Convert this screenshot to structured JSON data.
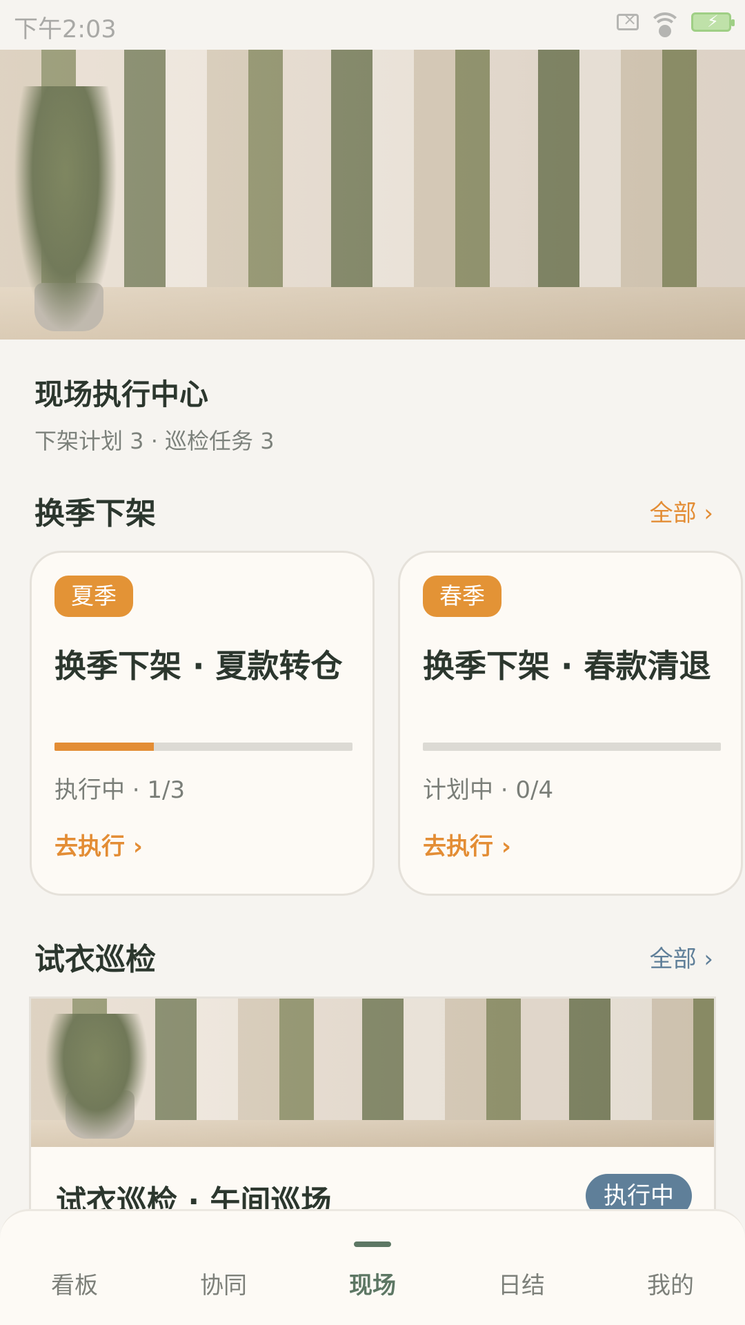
{
  "status_bar": {
    "time": "下午2:03"
  },
  "header": {
    "title": "现场执行中心",
    "subtitle": "下架计划 3 · 巡检任务 3"
  },
  "season_section": {
    "title": "换季下架",
    "all_label": "全部 ›",
    "link_color": "#e38d35",
    "cards": [
      {
        "tag": "夏季",
        "title": "换季下架 · 夏款转仓",
        "progress": 0.333,
        "status": "执行中 · 1/3",
        "action": "去执行 ›"
      },
      {
        "tag": "春季",
        "title": "换季下架 · 春款清退",
        "progress": 0,
        "status": "计划中 · 0/4",
        "action": "去执行 ›"
      }
    ]
  },
  "inspection_section": {
    "title": "试衣巡检",
    "all_label": "全部 ›",
    "link_color": "#5f7f99",
    "card": {
      "title": "试衣巡检 · 午间巡场",
      "badge": "执行中"
    }
  },
  "bottom_nav": {
    "active": "现场",
    "items": [
      "看板",
      "协同",
      "现场",
      "日结",
      "我的"
    ]
  },
  "colors": {
    "accent_orange": "#e38d35",
    "accent_green": "#5d7764",
    "accent_blue": "#5f7f99"
  }
}
